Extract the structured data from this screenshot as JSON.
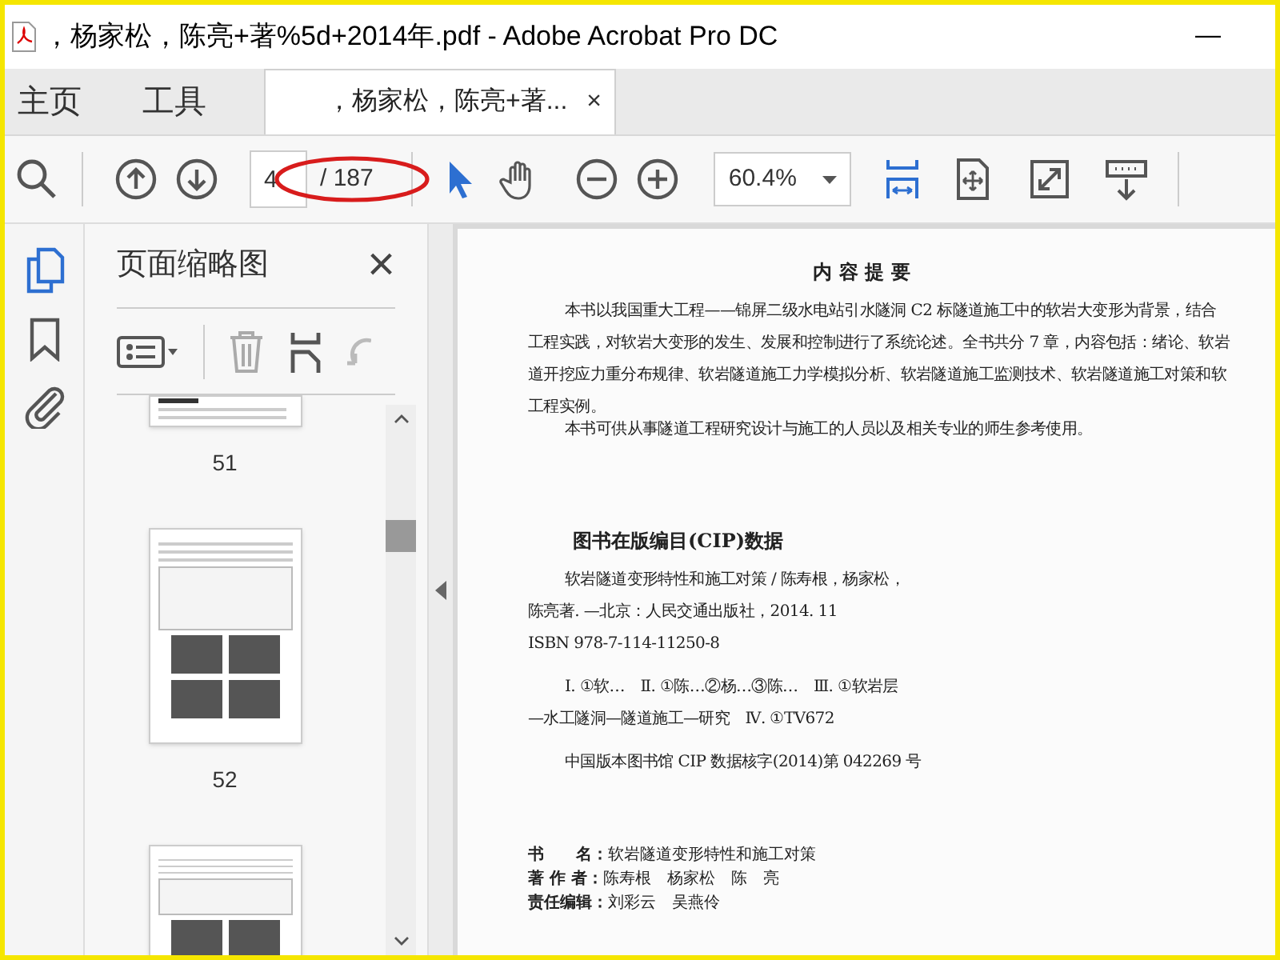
{
  "window": {
    "title": "，杨家松，陈亮+著%5d+2014年.pdf - Adobe Acrobat Pro DC",
    "controls": [
      "—"
    ]
  },
  "nav_tabs": [
    {
      "label": "主页",
      "selected": false
    },
    {
      "label": "工具",
      "selected": false
    }
  ],
  "document_tab": {
    "label": "，杨家松，陈亮+著...",
    "close": "×",
    "selected": true
  },
  "toolbar": {
    "page_value": "4",
    "page_total": "/ 187",
    "zoom": "60.4%"
  },
  "side_panel": {
    "title": "页面缩略图",
    "close": "×",
    "thumbnails": [
      {
        "label": "51",
        "kind": "bottom"
      },
      {
        "label": "52",
        "kind": "full"
      },
      {
        "kind": "top"
      }
    ]
  },
  "page": {
    "summary_title": "内 容 提 要",
    "paragraphs": [
      {
        "kind": "summary",
        "lines": [
          "本书以我国重大工程——锦屏二级水电站引水隧洞 C2 标隧道施工中的软岩大变形为背景，结合",
          "工程实践，对软岩大变形的发生、发展和控制进行了系统论述。全书共分 7 章，内容包括：绪论、软岩",
          "道开挖应力重分布规律、软岩隧道施工力学模拟分析、软岩隧道施工监测技术、软岩隧道施工对策和软",
          "工程实例。"
        ]
      },
      {
        "kind": "summary",
        "lines": [
          "本书可供从事隧道工程研究设计与施工的人员以及相关专业的师生参考使用。"
        ]
      }
    ],
    "cip_title": "图书在版编目(CIP)数据",
    "cip_paragraphs": [
      {
        "lines": [
          "软岩隧道变形特性和施工对策 / 陈寿根，杨家松，",
          "陈亮著. —北京：人民交通出版社，2014. 11",
          "ISBN 978-7-114-11250-8"
        ]
      },
      {
        "lines": [
          "Ⅰ. ①软…　Ⅱ. ①陈…②杨…③陈…　Ⅲ. ①软岩层",
          "—水工隧洞—隧道施工—研究　Ⅳ. ①TV672"
        ]
      },
      {
        "lines": [
          "中国版本图书馆 CIP 数据核字(2014)第 042269 号"
        ]
      }
    ],
    "book_info": [
      {
        "label": "书　　名：",
        "value": "软岩隧道变形特性和施工对策"
      },
      {
        "label": "著 作 者：",
        "value": "陈寿根　杨家松　陈　亮"
      },
      {
        "label": "责任编辑：",
        "value": "刘彩云　吴燕伶"
      }
    ]
  }
}
